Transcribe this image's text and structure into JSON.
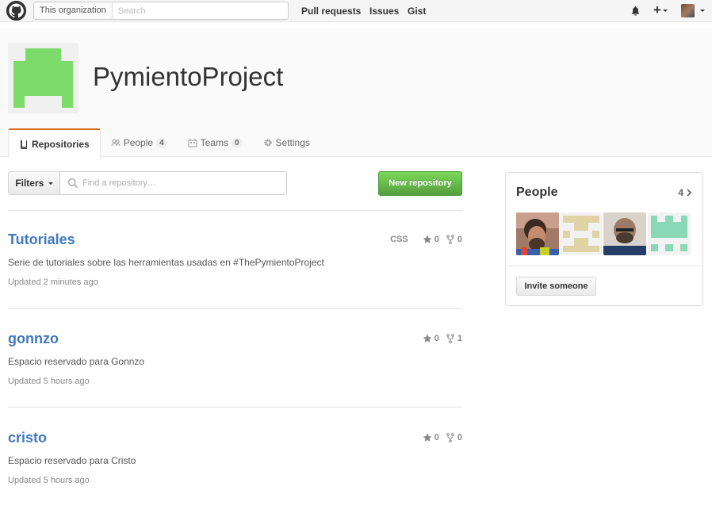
{
  "header": {
    "scope_label": "This organization",
    "search_placeholder": "Search",
    "nav": [
      "Pull requests",
      "Issues",
      "Gist"
    ],
    "plus_label": "+"
  },
  "org": {
    "name": "PymientoProject",
    "tabs": [
      {
        "label": "Repositories",
        "icon": "repo-icon",
        "selected": true
      },
      {
        "label": "People",
        "icon": "people-icon",
        "count": "4"
      },
      {
        "label": "Teams",
        "icon": "teams-icon",
        "count": "0"
      },
      {
        "label": "Settings",
        "icon": "gear-icon"
      }
    ]
  },
  "repos_toolbar": {
    "filters_label": "Filters",
    "find_placeholder": "Find a repository…",
    "new_repo_label": "New repository"
  },
  "repos": [
    {
      "name": "Tutoriales",
      "description": "Serie de tutoriales sobre las herramientas usadas en #ThePymientoProject",
      "updated": "Updated 2 minutes ago",
      "language": "CSS",
      "stars": "0",
      "forks": "0"
    },
    {
      "name": "gonnzo",
      "description": "Espacio reservado para Gonnzo",
      "updated": "Updated 5 hours ago",
      "language": "",
      "stars": "0",
      "forks": "1"
    },
    {
      "name": "cristo",
      "description": "Espacio reservado para Cristo",
      "updated": "Updated 5 hours ago",
      "language": "",
      "stars": "0",
      "forks": "0"
    }
  ],
  "people": {
    "title": "People",
    "count": "4",
    "invite_label": "Invite someone"
  },
  "colors": {
    "accent": "#4078c0",
    "tab_selected_border": "#d26911",
    "new_repo_green": "#60b044",
    "org_avatar_green": "#7ddb6a"
  }
}
